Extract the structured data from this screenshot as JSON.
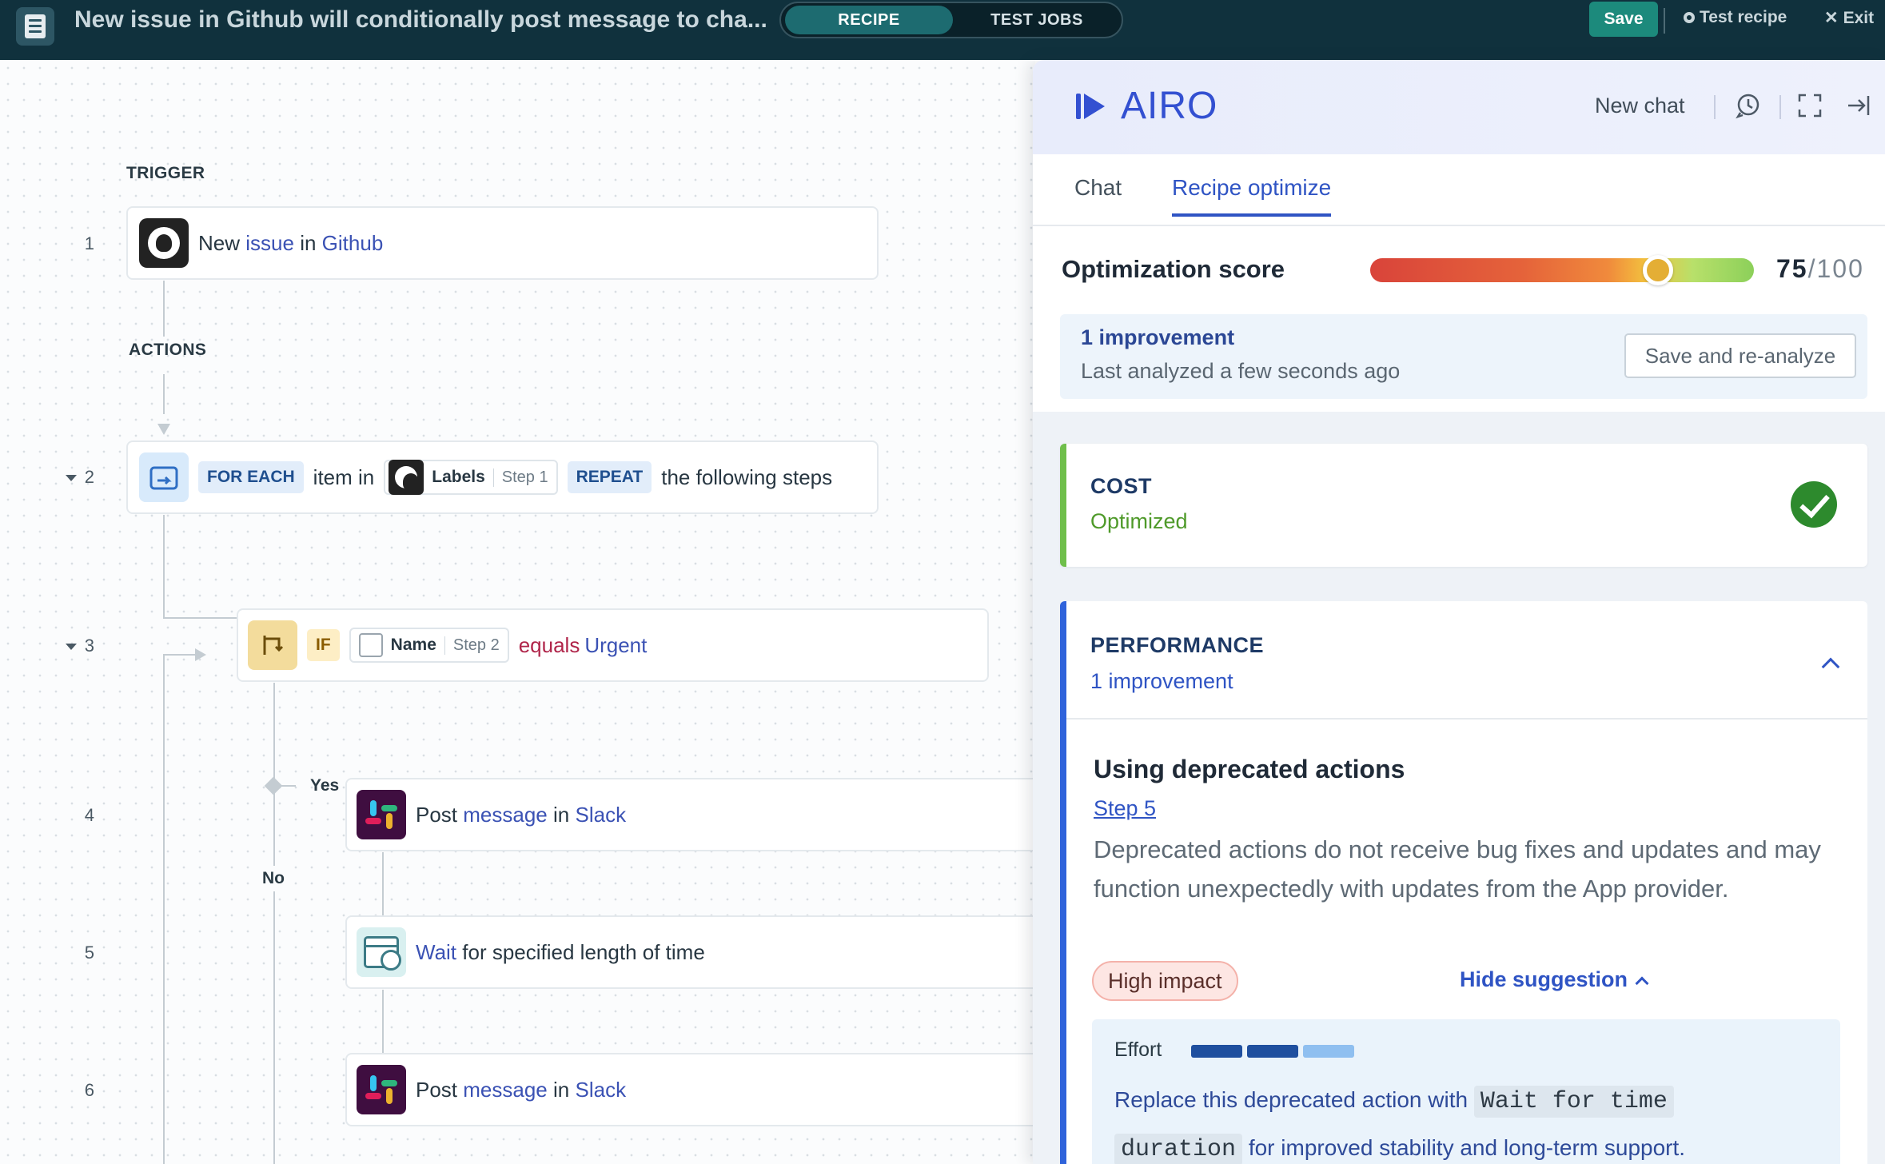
{
  "topbar": {
    "title": "New issue in Github will conditionally post message to cha...",
    "tab_recipe": "RECIPE",
    "tab_test_jobs": "TEST JOBS",
    "save_label": "Save",
    "test_recipe_label": "Test recipe",
    "exit_label": "Exit"
  },
  "canvas": {
    "trigger_label": "TRIGGER",
    "actions_label": "ACTIONS",
    "steps": [
      {
        "num": "1",
        "pre": "New",
        "link1": "issue",
        "mid": "in",
        "link2": "Github"
      },
      {
        "num": "2",
        "foreach": "FOR EACH",
        "item_in": "item in",
        "pill_name": "Labels",
        "pill_step": "Step 1",
        "repeat": "REPEAT",
        "tail": "the following steps"
      },
      {
        "num": "3",
        "if": "IF",
        "pill_name": "Name",
        "pill_step": "Step 2",
        "op": "equals",
        "value": "Urgent"
      },
      {
        "num": "4",
        "pre": "Post",
        "link1": "message",
        "mid": "in",
        "link2": "Slack"
      },
      {
        "num": "5",
        "link1": "Wait",
        "tail": "for specified length of time"
      },
      {
        "num": "6",
        "pre": "Post",
        "link1": "message",
        "mid": "in",
        "link2": "Slack"
      }
    ],
    "branch_yes": "Yes",
    "branch_no": "No"
  },
  "panel": {
    "brand": "AIRO",
    "new_chat": "New chat",
    "tabs": [
      "Chat",
      "Recipe optimize"
    ],
    "active_tab": "Recipe optimize",
    "score_label": "Optimization score",
    "score": 75,
    "score_value": "75",
    "score_max": "/100",
    "improvement_count": "1 improvement",
    "last_analyzed": "Last analyzed a few seconds ago",
    "reanalyze_label": "Save and re-analyze",
    "cost": {
      "title": "COST",
      "status": "Optimized",
      "status_color": "#4f9a2a"
    },
    "performance": {
      "title": "PERFORMANCE",
      "count": "1 improvement",
      "issue_title": "Using deprecated actions",
      "issue_step": "Step 5",
      "description": "Deprecated actions do not receive bug fixes and updates and may function unexpectedly with updates from the App provider.",
      "impact": "High impact",
      "hide_label": "Hide suggestion",
      "effort_label": "Effort",
      "effort_level": 2,
      "effort_max": 3,
      "suggestion_pre": "Replace this deprecated action with",
      "suggestion_code_1": "Wait for time",
      "suggestion_code_2": "duration",
      "suggestion_post": "for improved stability and long-term support."
    }
  },
  "colors": {
    "topbar_bg": "#10313d",
    "accent": "#2f54c4",
    "save_btn": "#1c8a7c",
    "optimized_green": "#4f9a2a"
  }
}
